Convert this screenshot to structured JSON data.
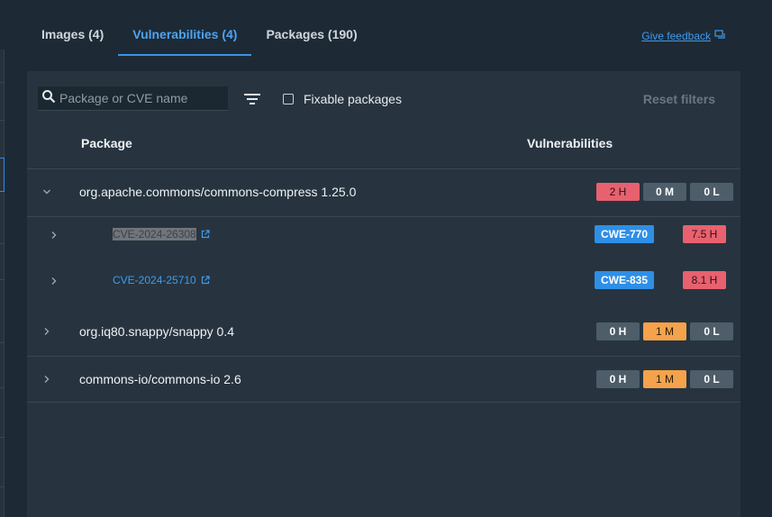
{
  "tabs": [
    {
      "label": "Images (4)",
      "active": false
    },
    {
      "label": "Vulnerabilities (4)",
      "active": true
    },
    {
      "label": "Packages (190)",
      "active": false
    }
  ],
  "feedback": {
    "label": "Give feedback",
    "icon": "feedback-icon"
  },
  "filters": {
    "search_placeholder": "Package or CVE name",
    "search_value": "",
    "fixable_label": "Fixable packages",
    "fixable_checked": false,
    "reset_label": "Reset filters"
  },
  "table": {
    "headers": {
      "package": "Package",
      "vulnerabilities": "Vulnerabilities"
    },
    "packages": [
      {
        "name": "org.apache.commons/commons-compress 1.25.0",
        "expanded": true,
        "counts": {
          "high": "2 H",
          "medium": "0 M",
          "low": "0 L"
        },
        "cves": [
          {
            "id": "CVE-2024-26308",
            "cwe": "CWE-770",
            "score": "7.5 H"
          },
          {
            "id": "CVE-2024-25710",
            "cwe": "CWE-835",
            "score": "8.1 H"
          }
        ]
      },
      {
        "name": "org.iq80.snappy/snappy 0.4",
        "expanded": false,
        "counts": {
          "high": "0 H",
          "medium": "1 M",
          "low": "0 L"
        }
      },
      {
        "name": "commons-io/commons-io 2.6",
        "expanded": false,
        "counts": {
          "high": "0 H",
          "medium": "1 M",
          "low": "0 L"
        }
      }
    ]
  },
  "colors": {
    "accent": "#3b91e8",
    "high": "#e8616f",
    "medium": "#f4a24b",
    "zero": "#4e5d6a",
    "cwe": "#2e8fe6"
  }
}
